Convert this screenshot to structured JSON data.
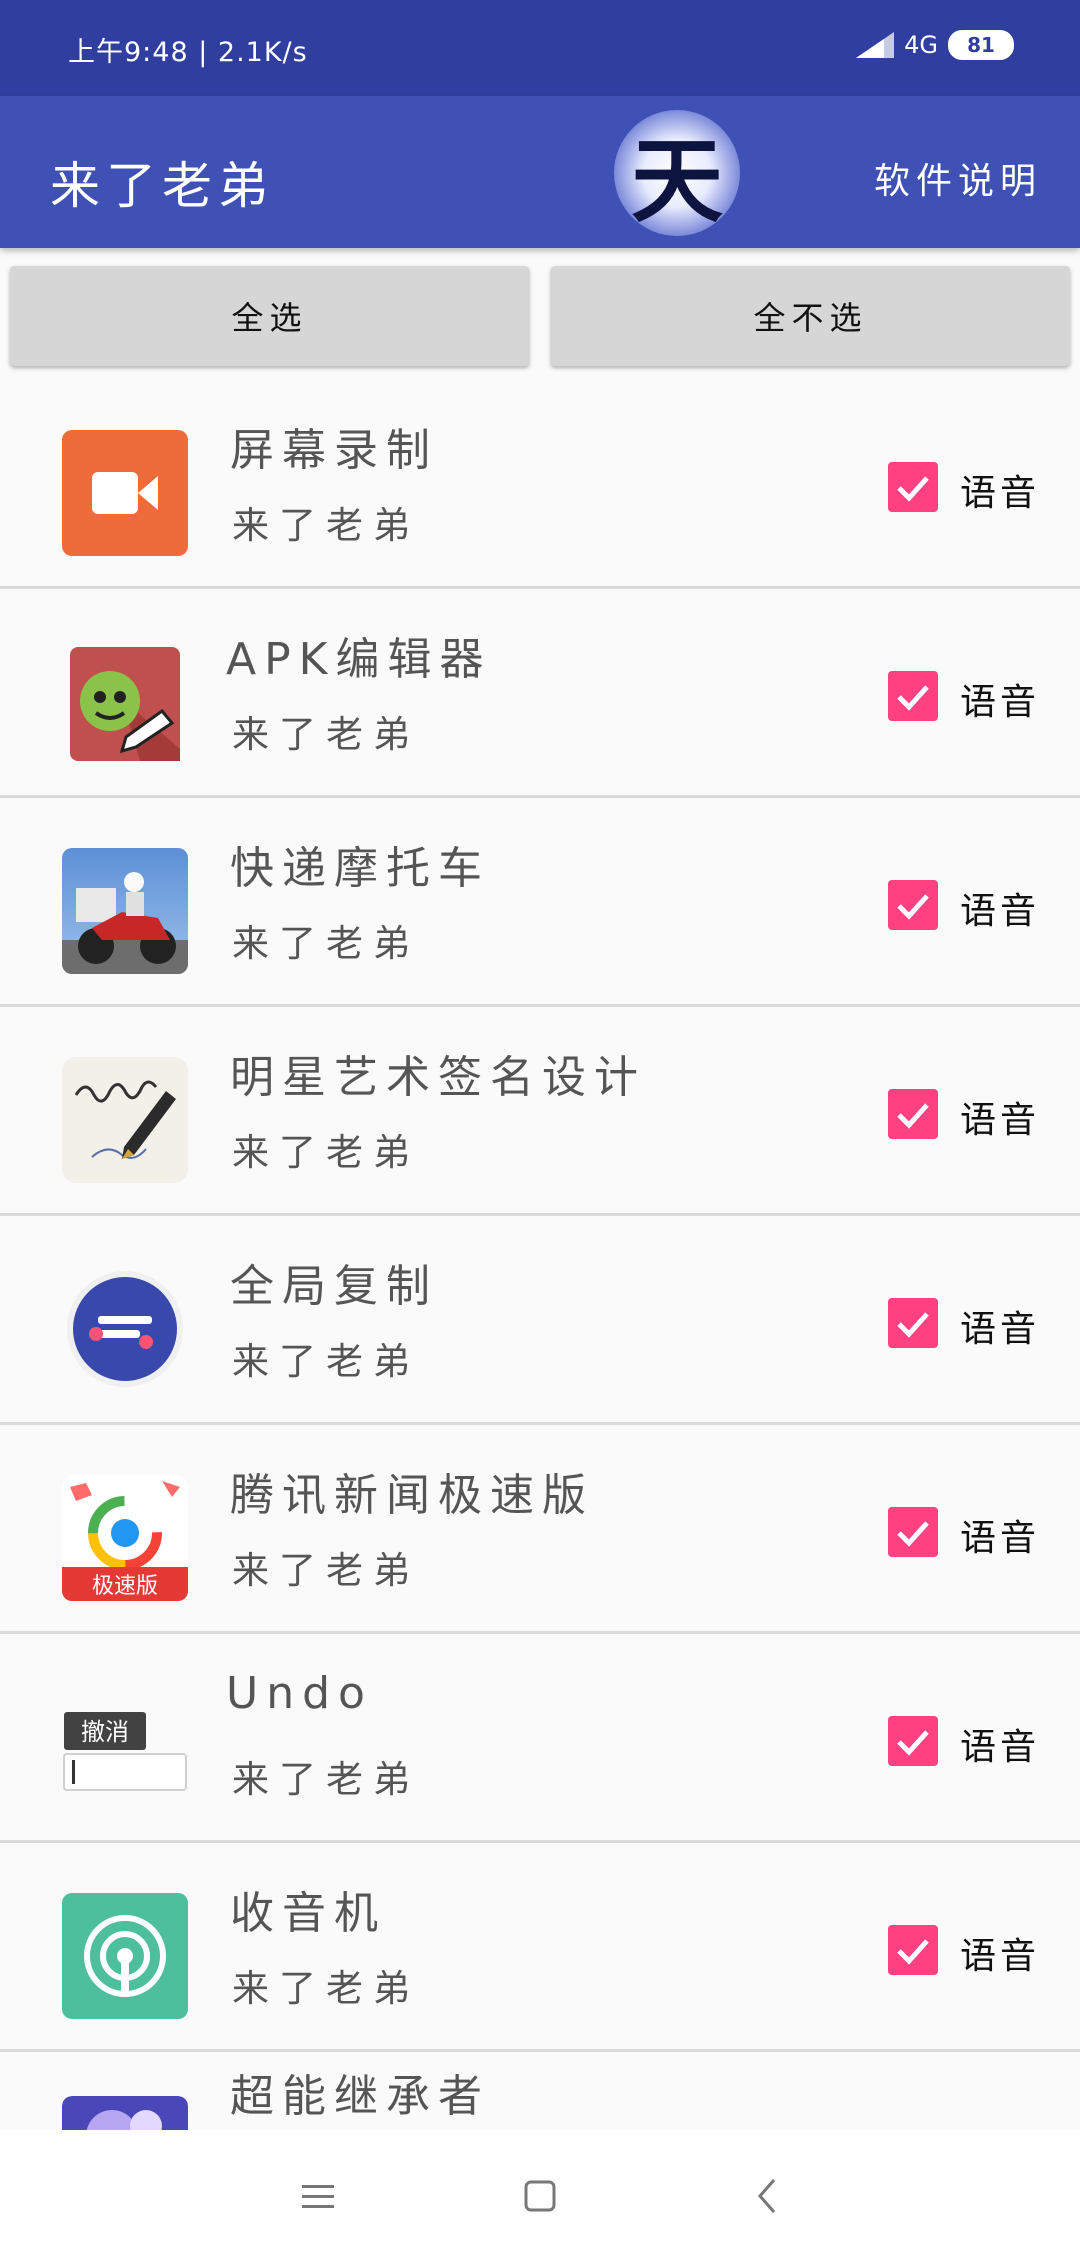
{
  "status_bar": {
    "time_speed": "上午9:48 | 2.1K/s",
    "network": "4G",
    "battery": "81"
  },
  "app_bar": {
    "title": "来了老弟",
    "logo_text": "天",
    "help_link": "软件说明"
  },
  "buttons": {
    "select_all": "全选",
    "select_none": "全不选"
  },
  "apps": [
    {
      "name": "屏幕录制",
      "subtitle": "来了老弟",
      "checked": true,
      "check_label": "语音",
      "icon": "screen-record-icon"
    },
    {
      "name": "APK编辑器",
      "subtitle": "来了老弟",
      "checked": true,
      "check_label": "语音",
      "icon": "apk-editor-icon"
    },
    {
      "name": "快递摩托车",
      "subtitle": "来了老弟",
      "checked": true,
      "check_label": "语音",
      "icon": "motorcycle-game-icon"
    },
    {
      "name": "明星艺术签名设计",
      "subtitle": "来了老弟",
      "checked": true,
      "check_label": "语音",
      "icon": "signature-pen-icon"
    },
    {
      "name": "全局复制",
      "subtitle": "来了老弟",
      "checked": true,
      "check_label": "语音",
      "icon": "global-copy-icon"
    },
    {
      "name": "腾讯新闻极速版",
      "subtitle": "来了老弟",
      "checked": true,
      "check_label": "语音",
      "icon": "tencent-news-icon",
      "badge": "极速版"
    },
    {
      "name": "Undo",
      "subtitle": "来了老弟",
      "checked": true,
      "check_label": "语音",
      "icon": "undo-icon",
      "badge": "撤消"
    },
    {
      "name": "收音机",
      "subtitle": "来了老弟",
      "checked": true,
      "check_label": "语音",
      "icon": "radio-icon"
    },
    {
      "name": "超能继承者",
      "icon": "game-character-icon"
    }
  ],
  "nav": {
    "icons": [
      "menu-icon",
      "home-icon",
      "back-icon"
    ]
  }
}
